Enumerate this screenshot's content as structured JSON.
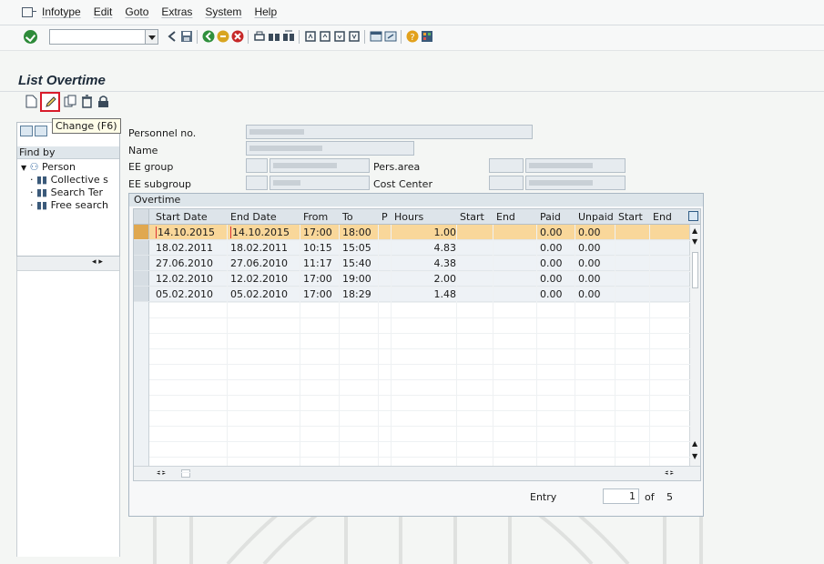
{
  "menu": [
    "Infotype",
    "Edit",
    "Goto",
    "Extras",
    "System",
    "Help"
  ],
  "screen_title": "List Overtime",
  "tooltip": "Change  (F6)",
  "nav": {
    "find_by": "Find by",
    "person": "Person",
    "items": [
      "Collective s",
      "Search Ter",
      "Free search"
    ]
  },
  "header": {
    "personnel_no_label": "Personnel no.",
    "name_label": "Name",
    "ee_group_label": "EE group",
    "ee_subgroup_label": "EE subgroup",
    "pers_area_label": "Pers.area",
    "cost_center_label": "Cost Center"
  },
  "overtime": {
    "group_title": "Overtime",
    "columns": [
      "Start Date",
      "End Date",
      "From",
      "To",
      "P",
      "Hours",
      "Start",
      "End",
      "Paid",
      "Unpaid",
      "Start",
      "End"
    ],
    "rows": [
      {
        "start_date": "14.10.2015",
        "end_date": "14.10.2015",
        "from": "17:00",
        "to": "18:00",
        "hours": "1.00",
        "paid": "0.00",
        "unpaid": "0.00"
      },
      {
        "start_date": "18.02.2011",
        "end_date": "18.02.2011",
        "from": "10:15",
        "to": "15:05",
        "hours": "4.83",
        "paid": "0.00",
        "unpaid": "0.00"
      },
      {
        "start_date": "27.06.2010",
        "end_date": "27.06.2010",
        "from": "11:17",
        "to": "15:40",
        "hours": "4.38",
        "paid": "0.00",
        "unpaid": "0.00"
      },
      {
        "start_date": "12.02.2010",
        "end_date": "12.02.2010",
        "from": "17:00",
        "to": "19:00",
        "hours": "2.00",
        "paid": "0.00",
        "unpaid": "0.00"
      },
      {
        "start_date": "05.02.2010",
        "end_date": "05.02.2010",
        "from": "17:00",
        "to": "18:29",
        "hours": "1.48",
        "paid": "0.00",
        "unpaid": "0.00"
      }
    ],
    "entry_label": "Entry",
    "entry_value": "1",
    "entry_of": "of",
    "entry_total": "5"
  },
  "colors": {
    "selected_row": "#f9d79a",
    "change_button_highlight": "#d81c2b"
  }
}
